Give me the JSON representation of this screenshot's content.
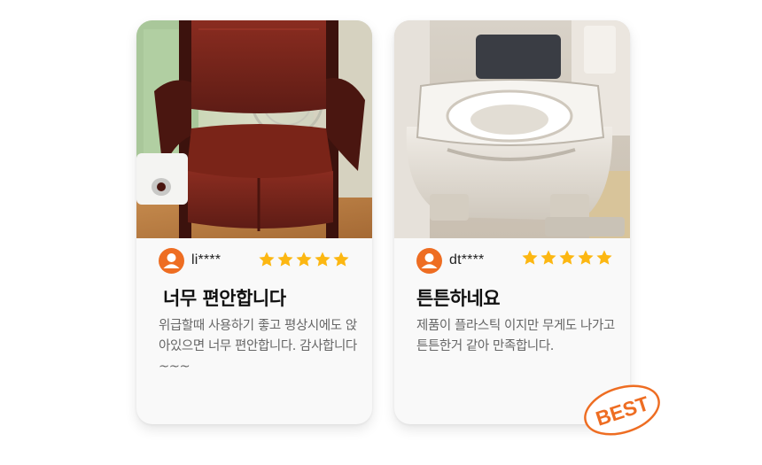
{
  "reviews": [
    {
      "username": "li****",
      "rating": 5,
      "title": "너무 편안합니다",
      "body": "위급할때 사용하기 좋고 평상시에도 앉아있으면 너무 편안합니다. 감사합니다~~~",
      "photo": "portable-toilet-chair-photo"
    },
    {
      "username": "dt****",
      "rating": 5,
      "title": "튼튼하네요",
      "body": "제품이 플라스틱 이지만 무게도 나가고 튼튼한거 같아 만족합니다.",
      "photo": "plastic-portable-toilet-photo"
    }
  ],
  "badge": {
    "label": "BEST",
    "color": "#ee6d22"
  },
  "colors": {
    "star": "#fcb712",
    "avatar": "#ee6d22"
  }
}
